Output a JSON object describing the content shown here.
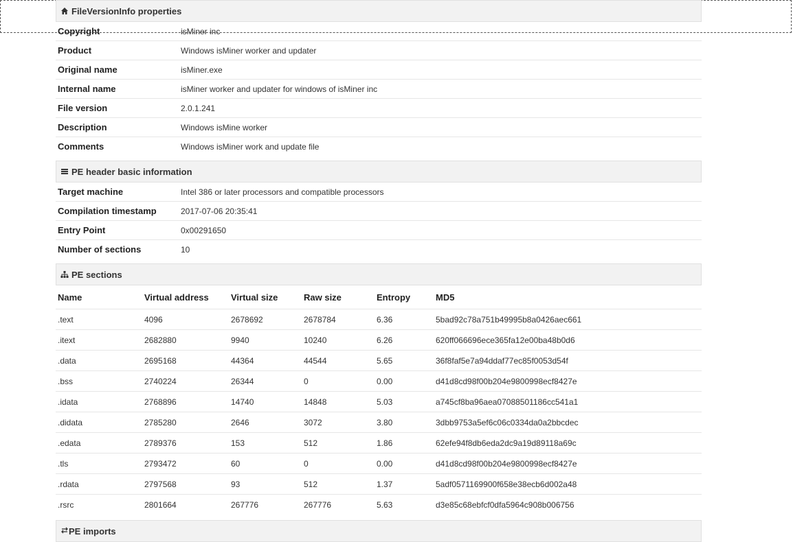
{
  "fileversion": {
    "title": "FileVersionInfo properties",
    "rows": [
      {
        "key": "Copyright",
        "value": "isMiner inc"
      },
      {
        "key": "Product",
        "value": "Windows isMiner worker and updater"
      },
      {
        "key": "Original name",
        "value": "isMiner.exe"
      },
      {
        "key": "Internal name",
        "value": "isMiner worker and updater for windows of isMiner inc"
      },
      {
        "key": "File version",
        "value": "2.0.1.241"
      },
      {
        "key": "Description",
        "value": "Windows isMine worker"
      },
      {
        "key": "Comments",
        "value": "Windows isMiner work and update file"
      }
    ]
  },
  "peheader": {
    "title": "PE header basic information",
    "rows": [
      {
        "key": "Target machine",
        "value": "Intel 386 or later processors and compatible processors"
      },
      {
        "key": "Compilation timestamp",
        "value": "2017-07-06 20:35:41"
      },
      {
        "key": "Entry Point",
        "value": "0x00291650"
      },
      {
        "key": "Number of sections",
        "value": "10"
      }
    ]
  },
  "pesections": {
    "title": "PE sections",
    "columns": [
      "Name",
      "Virtual address",
      "Virtual size",
      "Raw size",
      "Entropy",
      "MD5"
    ],
    "rows": [
      [
        ".text",
        "4096",
        "2678692",
        "2678784",
        "6.36",
        "5bad92c78a751b49995b8a0426aec661"
      ],
      [
        ".itext",
        "2682880",
        "9940",
        "10240",
        "6.26",
        "620ff066696ece365fa12e00ba48b0d6"
      ],
      [
        ".data",
        "2695168",
        "44364",
        "44544",
        "5.65",
        "36f8faf5e7a94ddaf77ec85f0053d54f"
      ],
      [
        ".bss",
        "2740224",
        "26344",
        "0",
        "0.00",
        "d41d8cd98f00b204e9800998ecf8427e"
      ],
      [
        ".idata",
        "2768896",
        "14740",
        "14848",
        "5.03",
        "a745cf8ba96aea07088501186cc541a1"
      ],
      [
        ".didata",
        "2785280",
        "2646",
        "3072",
        "3.80",
        "3dbb9753a5ef6c06c0334da0a2bbcdec"
      ],
      [
        ".edata",
        "2789376",
        "153",
        "512",
        "1.86",
        "62efe94f8db6eda2dc9a19d89118a69c"
      ],
      [
        ".tls",
        "2793472",
        "60",
        "0",
        "0.00",
        "d41d8cd98f00b204e9800998ecf8427e"
      ],
      [
        ".rdata",
        "2797568",
        "93",
        "512",
        "1.37",
        "5adf0571169900f658e38ecb6d002a48"
      ],
      [
        ".rsrc",
        "2801664",
        "267776",
        "267776",
        "5.63",
        "d3e85c68ebfcf0dfa5964c908b006756"
      ]
    ]
  },
  "peimports": {
    "title": "PE imports"
  }
}
